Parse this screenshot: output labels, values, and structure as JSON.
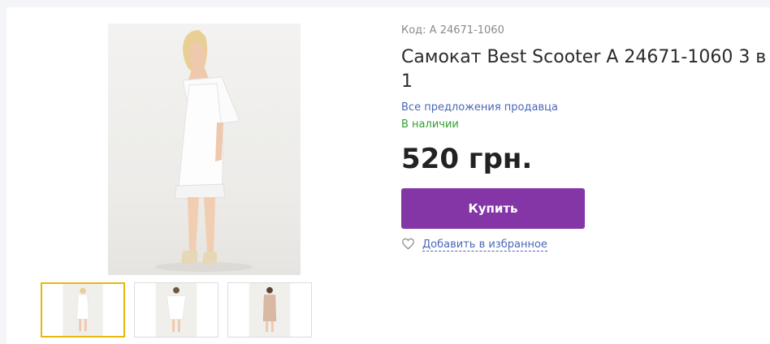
{
  "product": {
    "code_label": "Код: А 24671-1060",
    "title": "Самокат Best Scooter A 24671-1060 3 в 1",
    "seller_link": "Все предложения продавца",
    "availability": "В наличии",
    "price": "520 грн.",
    "buy_label": "Купить",
    "favorite_label": "Добавить в избранное",
    "favorite_icon": "heart-outline-icon"
  },
  "gallery": {
    "thumbnails": [
      {
        "name": "white-dress-photo",
        "active": true
      },
      {
        "name": "white-dress-front-photo",
        "active": false
      },
      {
        "name": "beige-dress-photo",
        "active": false
      }
    ]
  },
  "colors": {
    "accent": "#8436a7",
    "link": "#4a67b8",
    "in_stock": "#31a02f",
    "active_thumb_border": "#e8b70e"
  }
}
